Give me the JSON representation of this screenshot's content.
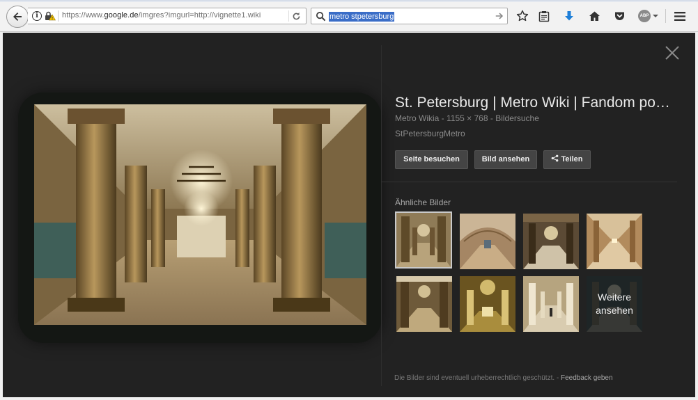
{
  "browser": {
    "url_prefix": "https://www.",
    "url_domain": "google.de",
    "url_path": "/imgres?imgurl=http://vignette1.wiki",
    "search_value": "metro stpetersburg"
  },
  "viewer": {
    "title": "St. Petersburg | Metro Wiki | Fandom powered by Wikia",
    "source": "Metro Wikia",
    "meta_sep1": " - ",
    "dimensions": "1155 × 768",
    "meta_sep2": " - ",
    "search_link": "Bildersuche",
    "subtitle": "StPetersburgMetro",
    "buttons": {
      "visit": "Seite besuchen",
      "view": "Bild ansehen",
      "share": "Teilen"
    },
    "similar_label": "Ähnliche Bilder",
    "more_line1": "Weitere",
    "more_line2": "ansehen",
    "footer_text": "Die Bilder sind eventuell urheberrechtlich geschützt.",
    "footer_sep": " - ",
    "footer_link": "Feedback geben"
  },
  "icons": {
    "abp_label": "ABP"
  },
  "colors": {
    "viewer_bg": "#222222",
    "button_bg": "#444444",
    "search_highlight": "#3a6dc7"
  }
}
